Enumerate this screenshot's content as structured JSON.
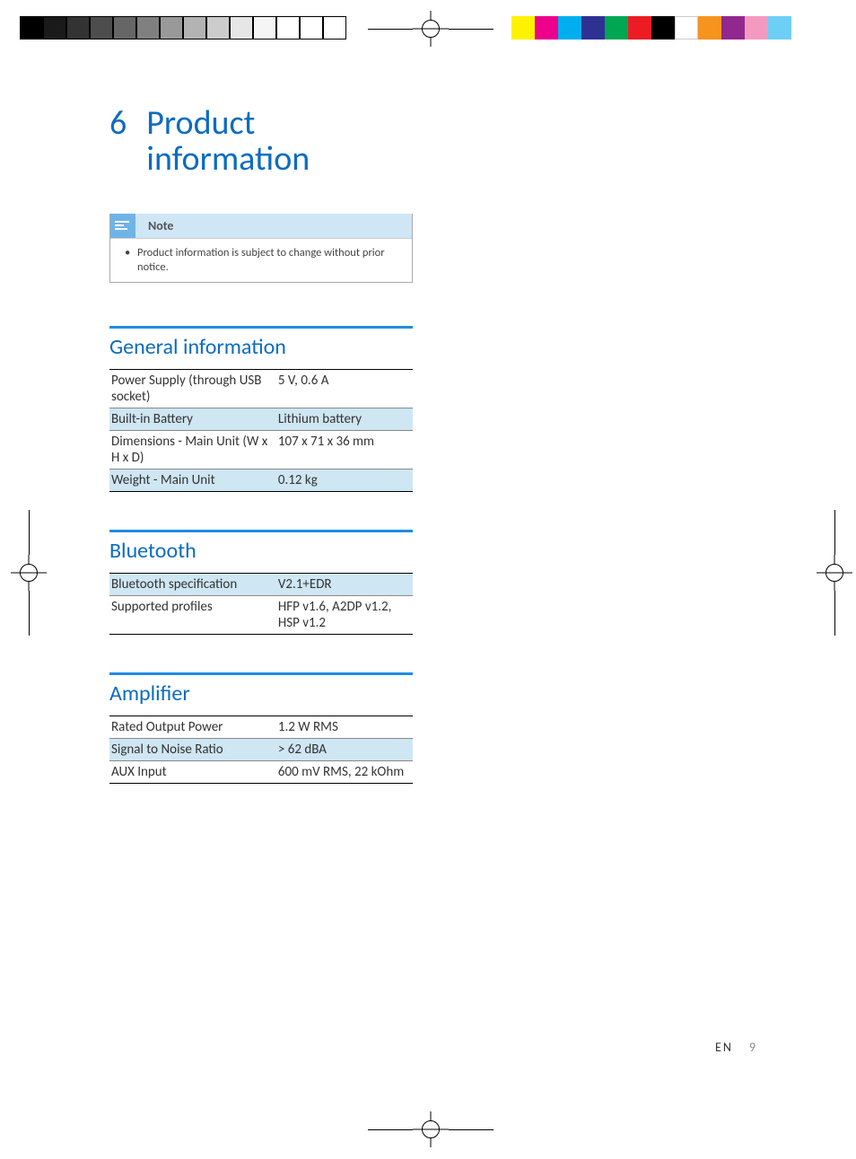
{
  "chapter": {
    "number": "6",
    "title": "Product information"
  },
  "note": {
    "label": "Note",
    "text": "Product information is subject to change without prior notice."
  },
  "sections": {
    "general": {
      "title": "General information",
      "rows": [
        {
          "label": "Power Supply (through USB socket)",
          "value": "5 V, 0.6 A",
          "shade": false
        },
        {
          "label": "Built-in Battery",
          "value": "Lithium battery",
          "shade": true
        },
        {
          "label": "Dimensions - Main Unit (W x H x D)",
          "value": "107 x 71 x 36 mm",
          "shade": false
        },
        {
          "label": "Weight - Main Unit",
          "value": "0.12 kg",
          "shade": true
        }
      ]
    },
    "bluetooth": {
      "title": "Bluetooth",
      "rows": [
        {
          "label": "Bluetooth specification",
          "value": "V2.1+EDR",
          "shade": true
        },
        {
          "label": "Supported profiles",
          "value": "HFP v1.6, A2DP v1.2, HSP v1.2",
          "shade": false
        }
      ]
    },
    "amplifier": {
      "title": "Amplifier",
      "rows": [
        {
          "label": "Rated Output Power",
          "value": "1.2 W RMS",
          "shade": false
        },
        {
          "label": "Signal to Noise Ratio",
          "value": "> 62 dBA",
          "shade": true
        },
        {
          "label": "AUX Input",
          "value": "600 mV RMS, 22 kOhm",
          "shade": false
        }
      ]
    }
  },
  "footer": {
    "lang": "EN",
    "page": "9"
  }
}
